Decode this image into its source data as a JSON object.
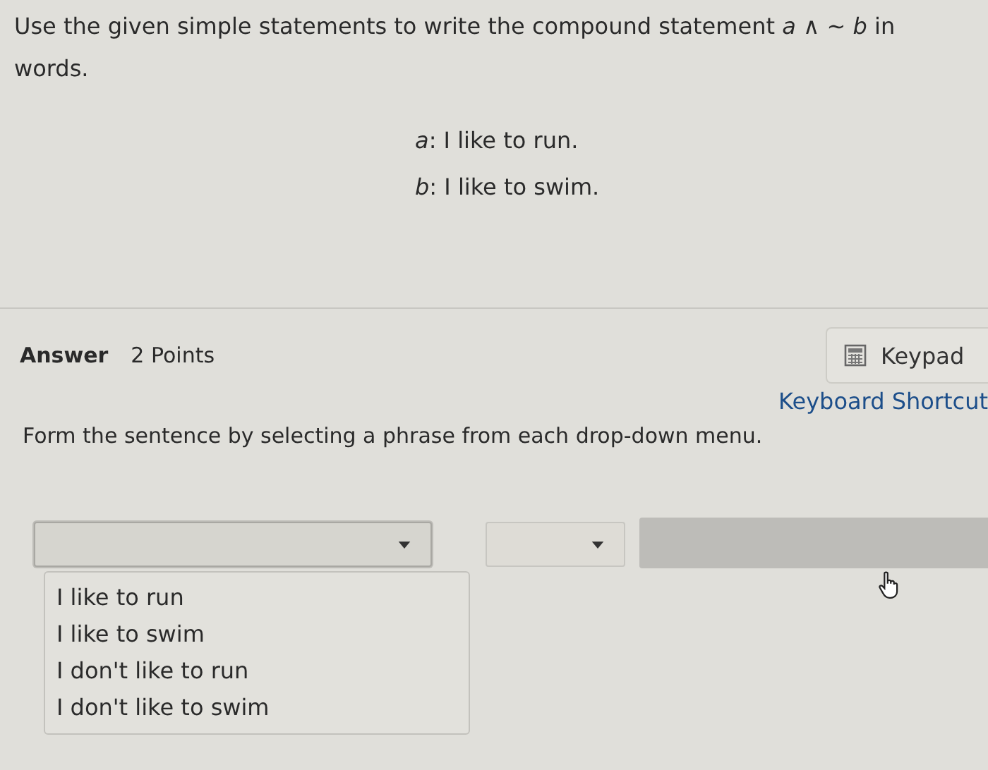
{
  "question": {
    "prompt": "Use the given simple statements to write the compound statement *a* ∧  ~ *b* in words.",
    "statements": [
      "*a*: I like to run.",
      "*b*: I like to swim."
    ]
  },
  "answer": {
    "label": "Answer",
    "points": "2 Points",
    "keypad": "Keypad",
    "shortcuts": "Keyboard Shortcut",
    "instruction": "Form the sentence by selecting a phrase from each drop-down menu.",
    "dropdowns": [
      {
        "kind": "select",
        "expanded": true,
        "options": [
          "I like to run",
          "I like to swim",
          "I don't like to run",
          "I don't like to swim"
        ]
      },
      {
        "kind": "select",
        "expanded": false
      },
      {
        "kind": "field",
        "disabled": true
      }
    ]
  }
}
